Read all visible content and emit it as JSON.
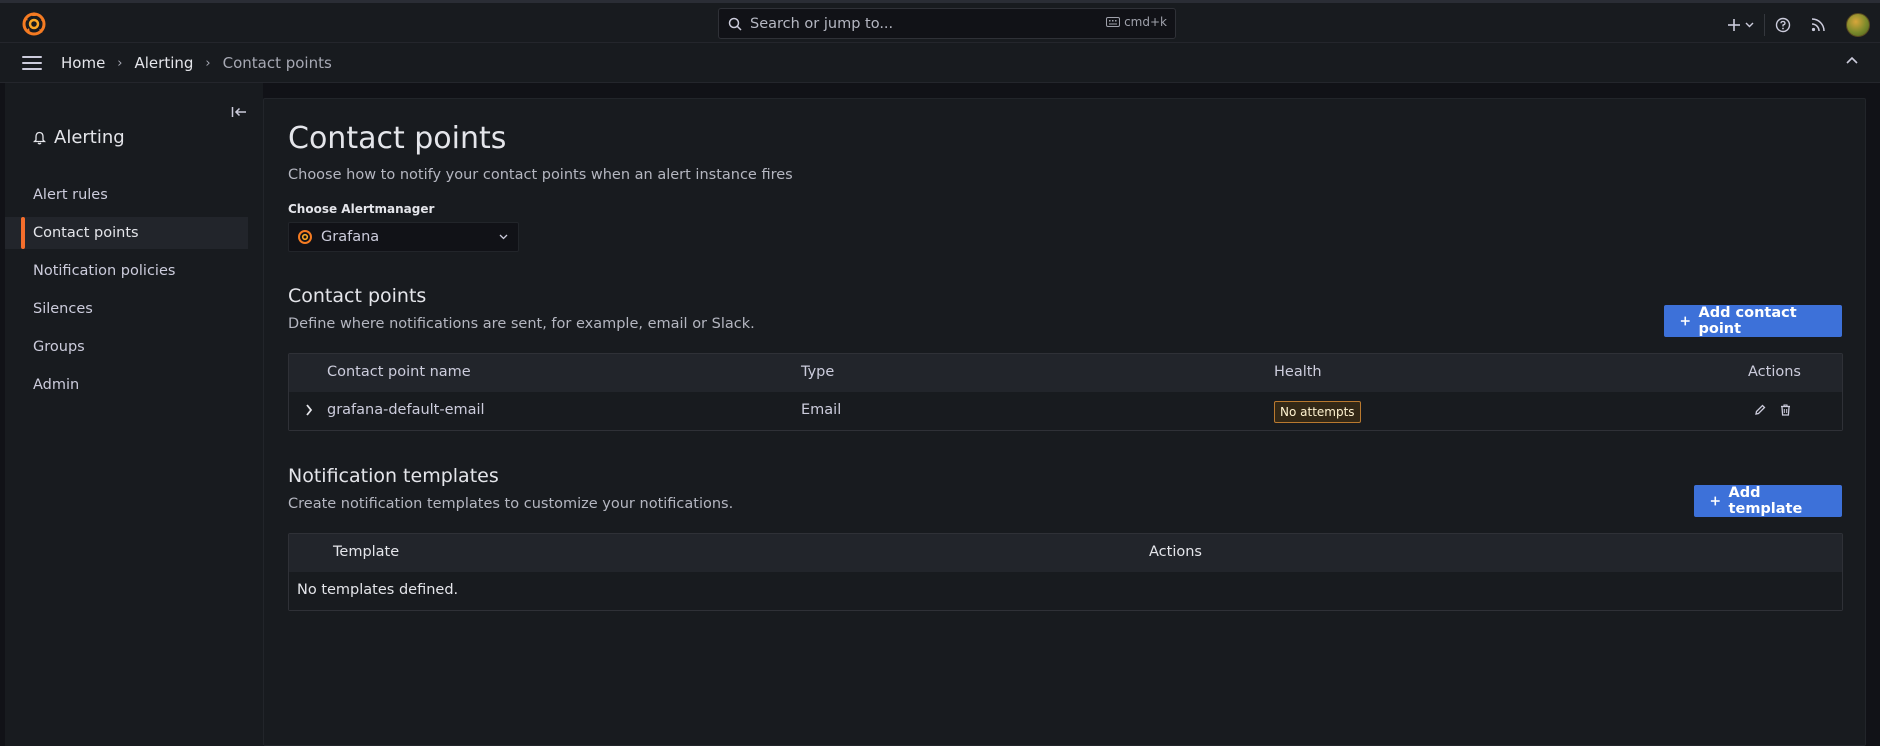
{
  "topbar": {
    "search_placeholder": "Search or jump to...",
    "search_shortcut": "cmd+k",
    "new_button_icon": "plus-icon"
  },
  "breadcrumb": {
    "items": [
      "Home",
      "Alerting",
      "Contact points"
    ]
  },
  "sidebar": {
    "title": "Alerting",
    "items": [
      {
        "label": "Alert rules",
        "active": false
      },
      {
        "label": "Contact points",
        "active": true
      },
      {
        "label": "Notification policies",
        "active": false
      },
      {
        "label": "Silences",
        "active": false
      },
      {
        "label": "Groups",
        "active": false
      },
      {
        "label": "Admin",
        "active": false
      }
    ]
  },
  "page": {
    "title": "Contact points",
    "subtitle": "Choose how to notify your contact points when an alert instance fires",
    "alertmanager_label": "Choose Alertmanager",
    "alertmanager_value": "Grafana"
  },
  "contact_points": {
    "title": "Contact points",
    "subtitle": "Define where notifications are sent, for example, email or Slack.",
    "add_button": "Add contact point",
    "columns": [
      "Contact point name",
      "Type",
      "Health",
      "Actions"
    ],
    "rows": [
      {
        "name": "grafana-default-email",
        "type": "Email",
        "health": "No attempts"
      }
    ]
  },
  "templates": {
    "title": "Notification templates",
    "subtitle": "Create notification templates to customize your notifications.",
    "add_button": "Add template",
    "columns": [
      "Template",
      "Actions"
    ],
    "empty_text": "No templates defined."
  },
  "colors": {
    "accent": "#f56e2c",
    "primary": "#3d71d9",
    "warning_border": "#b9792f"
  }
}
